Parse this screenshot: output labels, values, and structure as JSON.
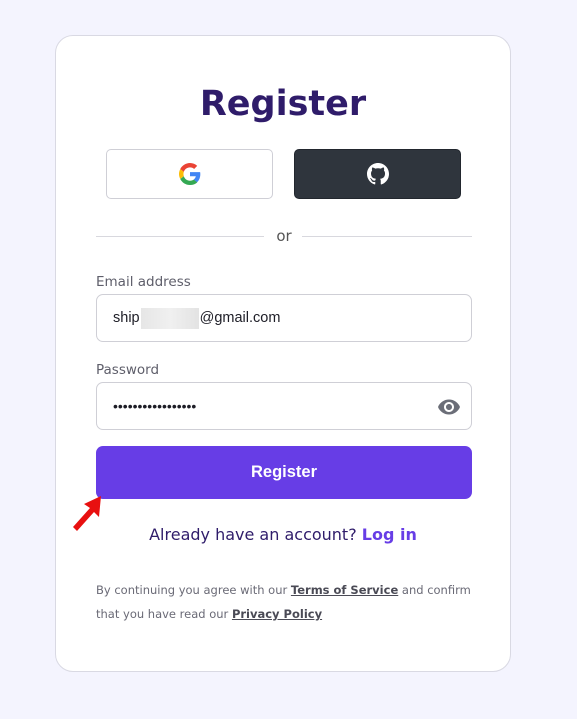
{
  "title": "Register",
  "social": {
    "google_icon": "google-g-icon",
    "github_icon": "github-octocat-icon"
  },
  "divider_text": "or",
  "email": {
    "label": "Email address",
    "value_prefix": "ship",
    "value_suffix": "@gmail.com"
  },
  "password": {
    "label": "Password",
    "masked_value": "•••••••••••••••••",
    "toggle_icon": "eye-icon"
  },
  "register_button": "Register",
  "login": {
    "prompt": "Already have an account?",
    "link": "Log in"
  },
  "legal": {
    "text1": "By continuing you agree with our",
    "terms": "Terms of Service",
    "text2": "and confirm that you have read our",
    "privacy": "Privacy Policy"
  },
  "colors": {
    "accent": "#673de6",
    "title": "#2f1c6a",
    "github_bg": "#2f353d",
    "page_bg": "#f4f4fe",
    "annotation_arrow": "#e81010"
  }
}
